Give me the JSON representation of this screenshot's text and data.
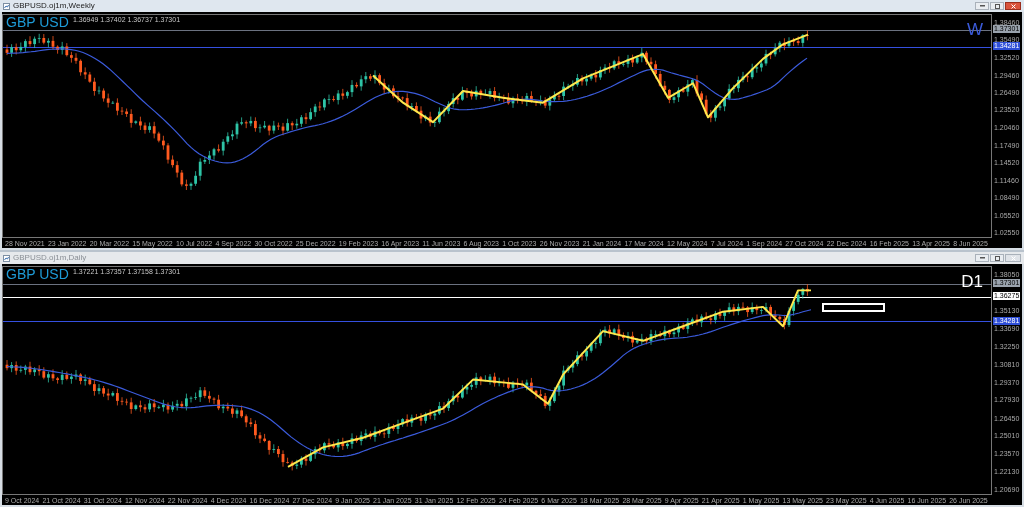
{
  "windows": [
    {
      "title": "GBPUSD.oj1m,Weekly",
      "active": true,
      "symbol_label": "GBP USD",
      "ohlc": "1.36949 1.37402 1.36737 1.37301",
      "timeframe_label": "W",
      "price_axis": [
        "1.38460",
        "1.35490",
        "1.32520",
        "1.29460",
        "1.26490",
        "1.23520",
        "1.20460",
        "1.17490",
        "1.14520",
        "1.11460",
        "1.08490",
        "1.05520",
        "1.02550"
      ],
      "price_tags": [
        {
          "text": "1.37301",
          "kind": "bid"
        },
        {
          "text": "1.34281",
          "kind": "level"
        }
      ],
      "date_axis": [
        "28 Nov 2021",
        "23 Jan 2022",
        "20 Mar 2022",
        "15 May 2022",
        "10 Jul 2022",
        "4 Sep 2022",
        "30 Oct 2022",
        "25 Dec 2022",
        "19 Feb 2023",
        "16 Apr 2023",
        "11 Jun 2023",
        "6 Aug 2023",
        "1 Oct 2023",
        "26 Nov 2023",
        "21 Jan 2024",
        "17 Mar 2024",
        "12 May 2024",
        "7 Jul 2024",
        "1 Sep 2024",
        "27 Oct 2024",
        "22 Dec 2024",
        "16 Feb 2025",
        "13 Apr 2025",
        "8 Jun 2025"
      ]
    },
    {
      "title": "GBPUSD.oj1m,Daily",
      "active": false,
      "symbol_label": "GBP USD",
      "ohlc": "1.37221 1.37357 1.37158 1.37301",
      "timeframe_label": "D1",
      "price_axis": [
        "1.38050",
        "1.35130",
        "1.33690",
        "1.32250",
        "1.30810",
        "1.29370",
        "1.27930",
        "1.26450",
        "1.25010",
        "1.23570",
        "1.22130",
        "1.20690"
      ],
      "price_tags": [
        {
          "text": "1.37301",
          "kind": "bid"
        },
        {
          "text": "1.36275",
          "kind": "line"
        },
        {
          "text": "1.34281",
          "kind": "level"
        }
      ],
      "date_axis": [
        "9 Oct 2024",
        "21 Oct 2024",
        "31 Oct 2024",
        "12 Nov 2024",
        "22 Nov 2024",
        "4 Dec 2024",
        "16 Dec 2024",
        "27 Dec 2024",
        "9 Jan 2025",
        "21 Jan 2025",
        "31 Jan 2025",
        "12 Feb 2025",
        "24 Feb 2025",
        "6 Mar 2025",
        "18 Mar 2025",
        "28 Mar 2025",
        "9 Apr 2025",
        "21 Apr 2025",
        "1 May 2025",
        "13 May 2025",
        "23 May 2025",
        "4 Jun 2025",
        "16 Jun 2025",
        "26 Jun 2025"
      ]
    }
  ]
}
